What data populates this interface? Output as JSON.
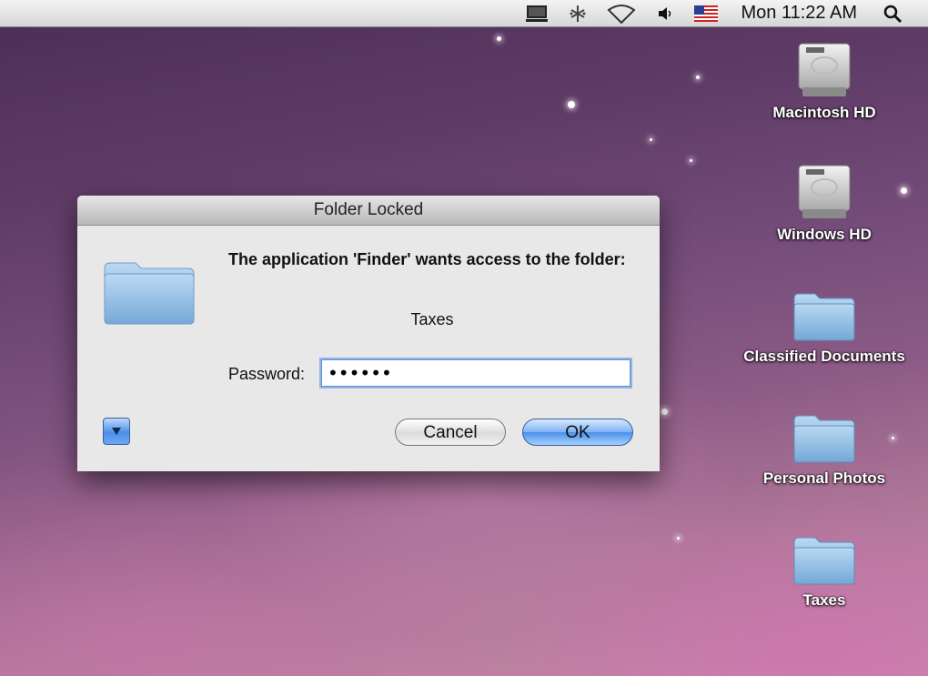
{
  "menubar": {
    "clock": "Mon 11:22 AM",
    "icons": [
      "display-icon",
      "bluetooth-icon",
      "wifi-icon",
      "volume-icon",
      "us-flag-icon",
      "spotlight-icon"
    ]
  },
  "desktop": {
    "items": [
      {
        "label": "Macintosh HD",
        "icon": "hard-drive-icon"
      },
      {
        "label": "Windows HD",
        "icon": "hard-drive-icon"
      },
      {
        "label": "Classified Documents",
        "icon": "folder-icon"
      },
      {
        "label": "Personal Photos",
        "icon": "folder-icon"
      },
      {
        "label": "Taxes",
        "icon": "folder-icon"
      }
    ]
  },
  "dialog": {
    "title": "Folder Locked",
    "message": "The application 'Finder' wants access to the folder:",
    "folder_name": "Taxes",
    "password_label": "Password:",
    "password_value": "••••••",
    "cancel_label": "Cancel",
    "ok_label": "OK",
    "accent_color": "#4b90e8"
  }
}
